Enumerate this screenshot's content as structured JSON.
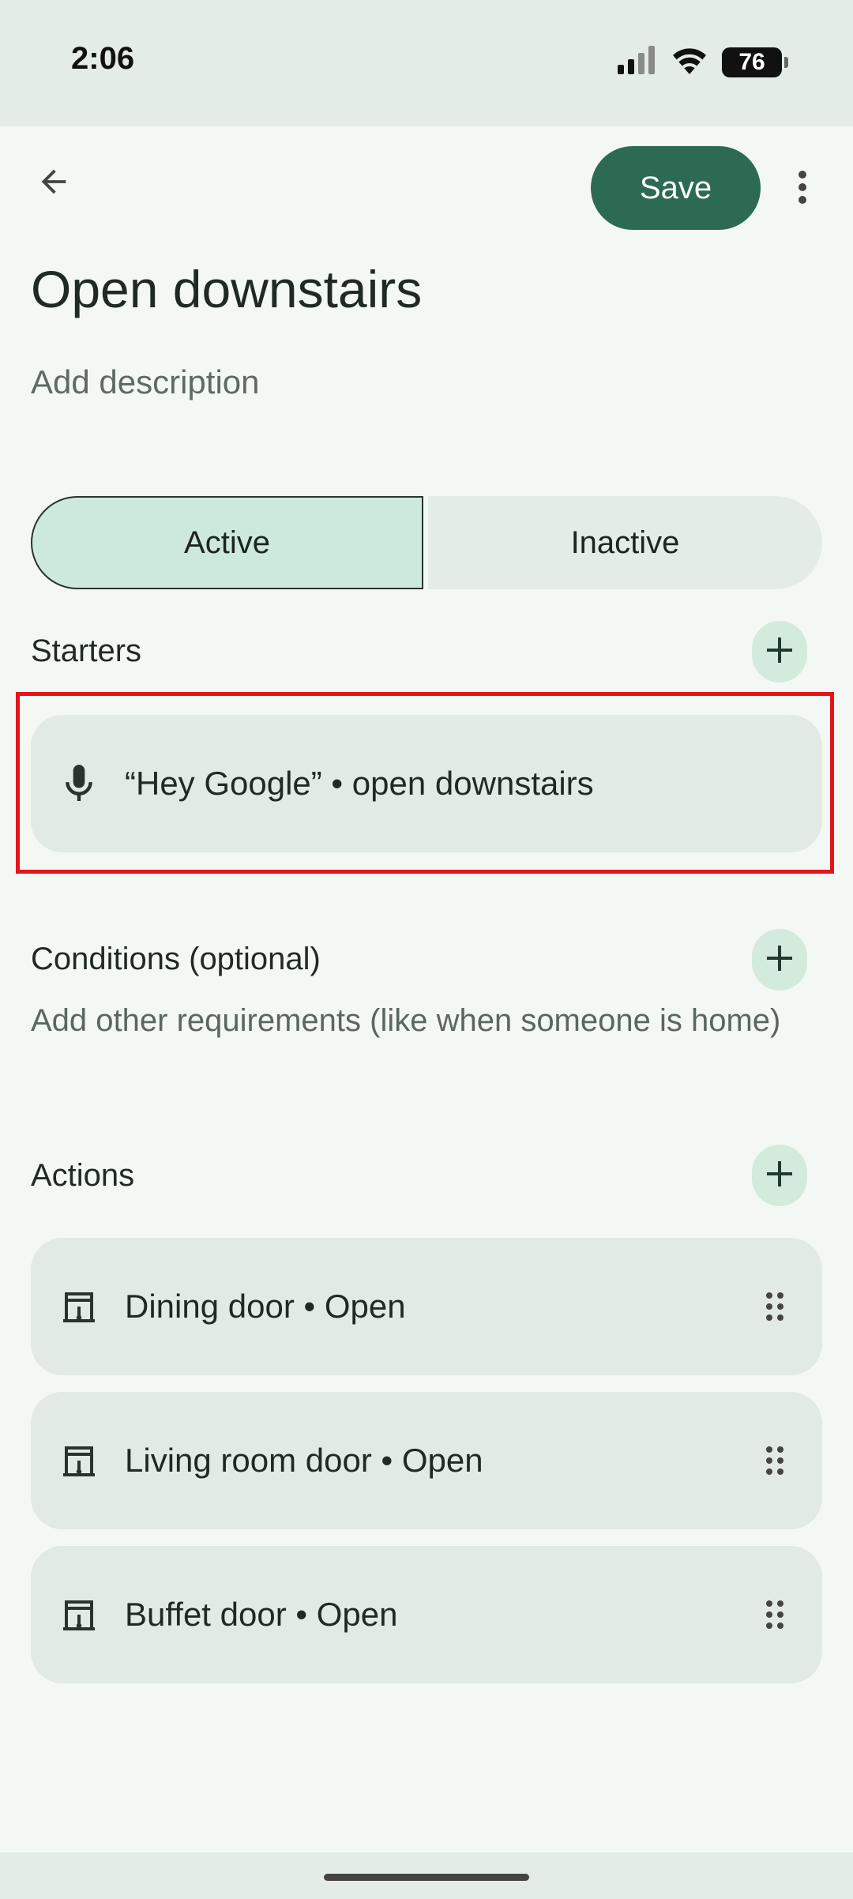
{
  "status_bar": {
    "time": "2:06",
    "battery": "76",
    "icons": [
      "signal-icon",
      "wifi-icon",
      "battery-icon"
    ]
  },
  "header": {
    "back_icon": "arrow-back-icon",
    "save_label": "Save",
    "more_icon": "more-vert-icon"
  },
  "title": "Open downstairs",
  "description_placeholder": "Add description",
  "status_toggle": {
    "active_label": "Active",
    "inactive_label": "Inactive",
    "selected": "Active"
  },
  "starters": {
    "label": "Starters",
    "add_icon": "plus-icon",
    "items": [
      {
        "icon": "mic-icon",
        "text": "“Hey Google” • open downstairs"
      }
    ]
  },
  "conditions": {
    "label": "Conditions (optional)",
    "subtitle": "Add other requirements (like when someone is home)",
    "add_icon": "plus-icon"
  },
  "actions": {
    "label": "Actions",
    "add_icon": "plus-icon",
    "items": [
      {
        "icon": "door-icon",
        "text": "Dining door • Open",
        "handle_icon": "drag-handle-icon"
      },
      {
        "icon": "door-icon",
        "text": "Living room door • Open",
        "handle_icon": "drag-handle-icon"
      },
      {
        "icon": "door-icon",
        "text": "Buffet door • Open",
        "handle_icon": "drag-handle-icon"
      }
    ]
  },
  "colors": {
    "background": "#f4f8f4",
    "primary": "#2d6a53",
    "active_segment": "#cde9db",
    "card": "#e1eae3",
    "highlight": "#e5141a"
  }
}
